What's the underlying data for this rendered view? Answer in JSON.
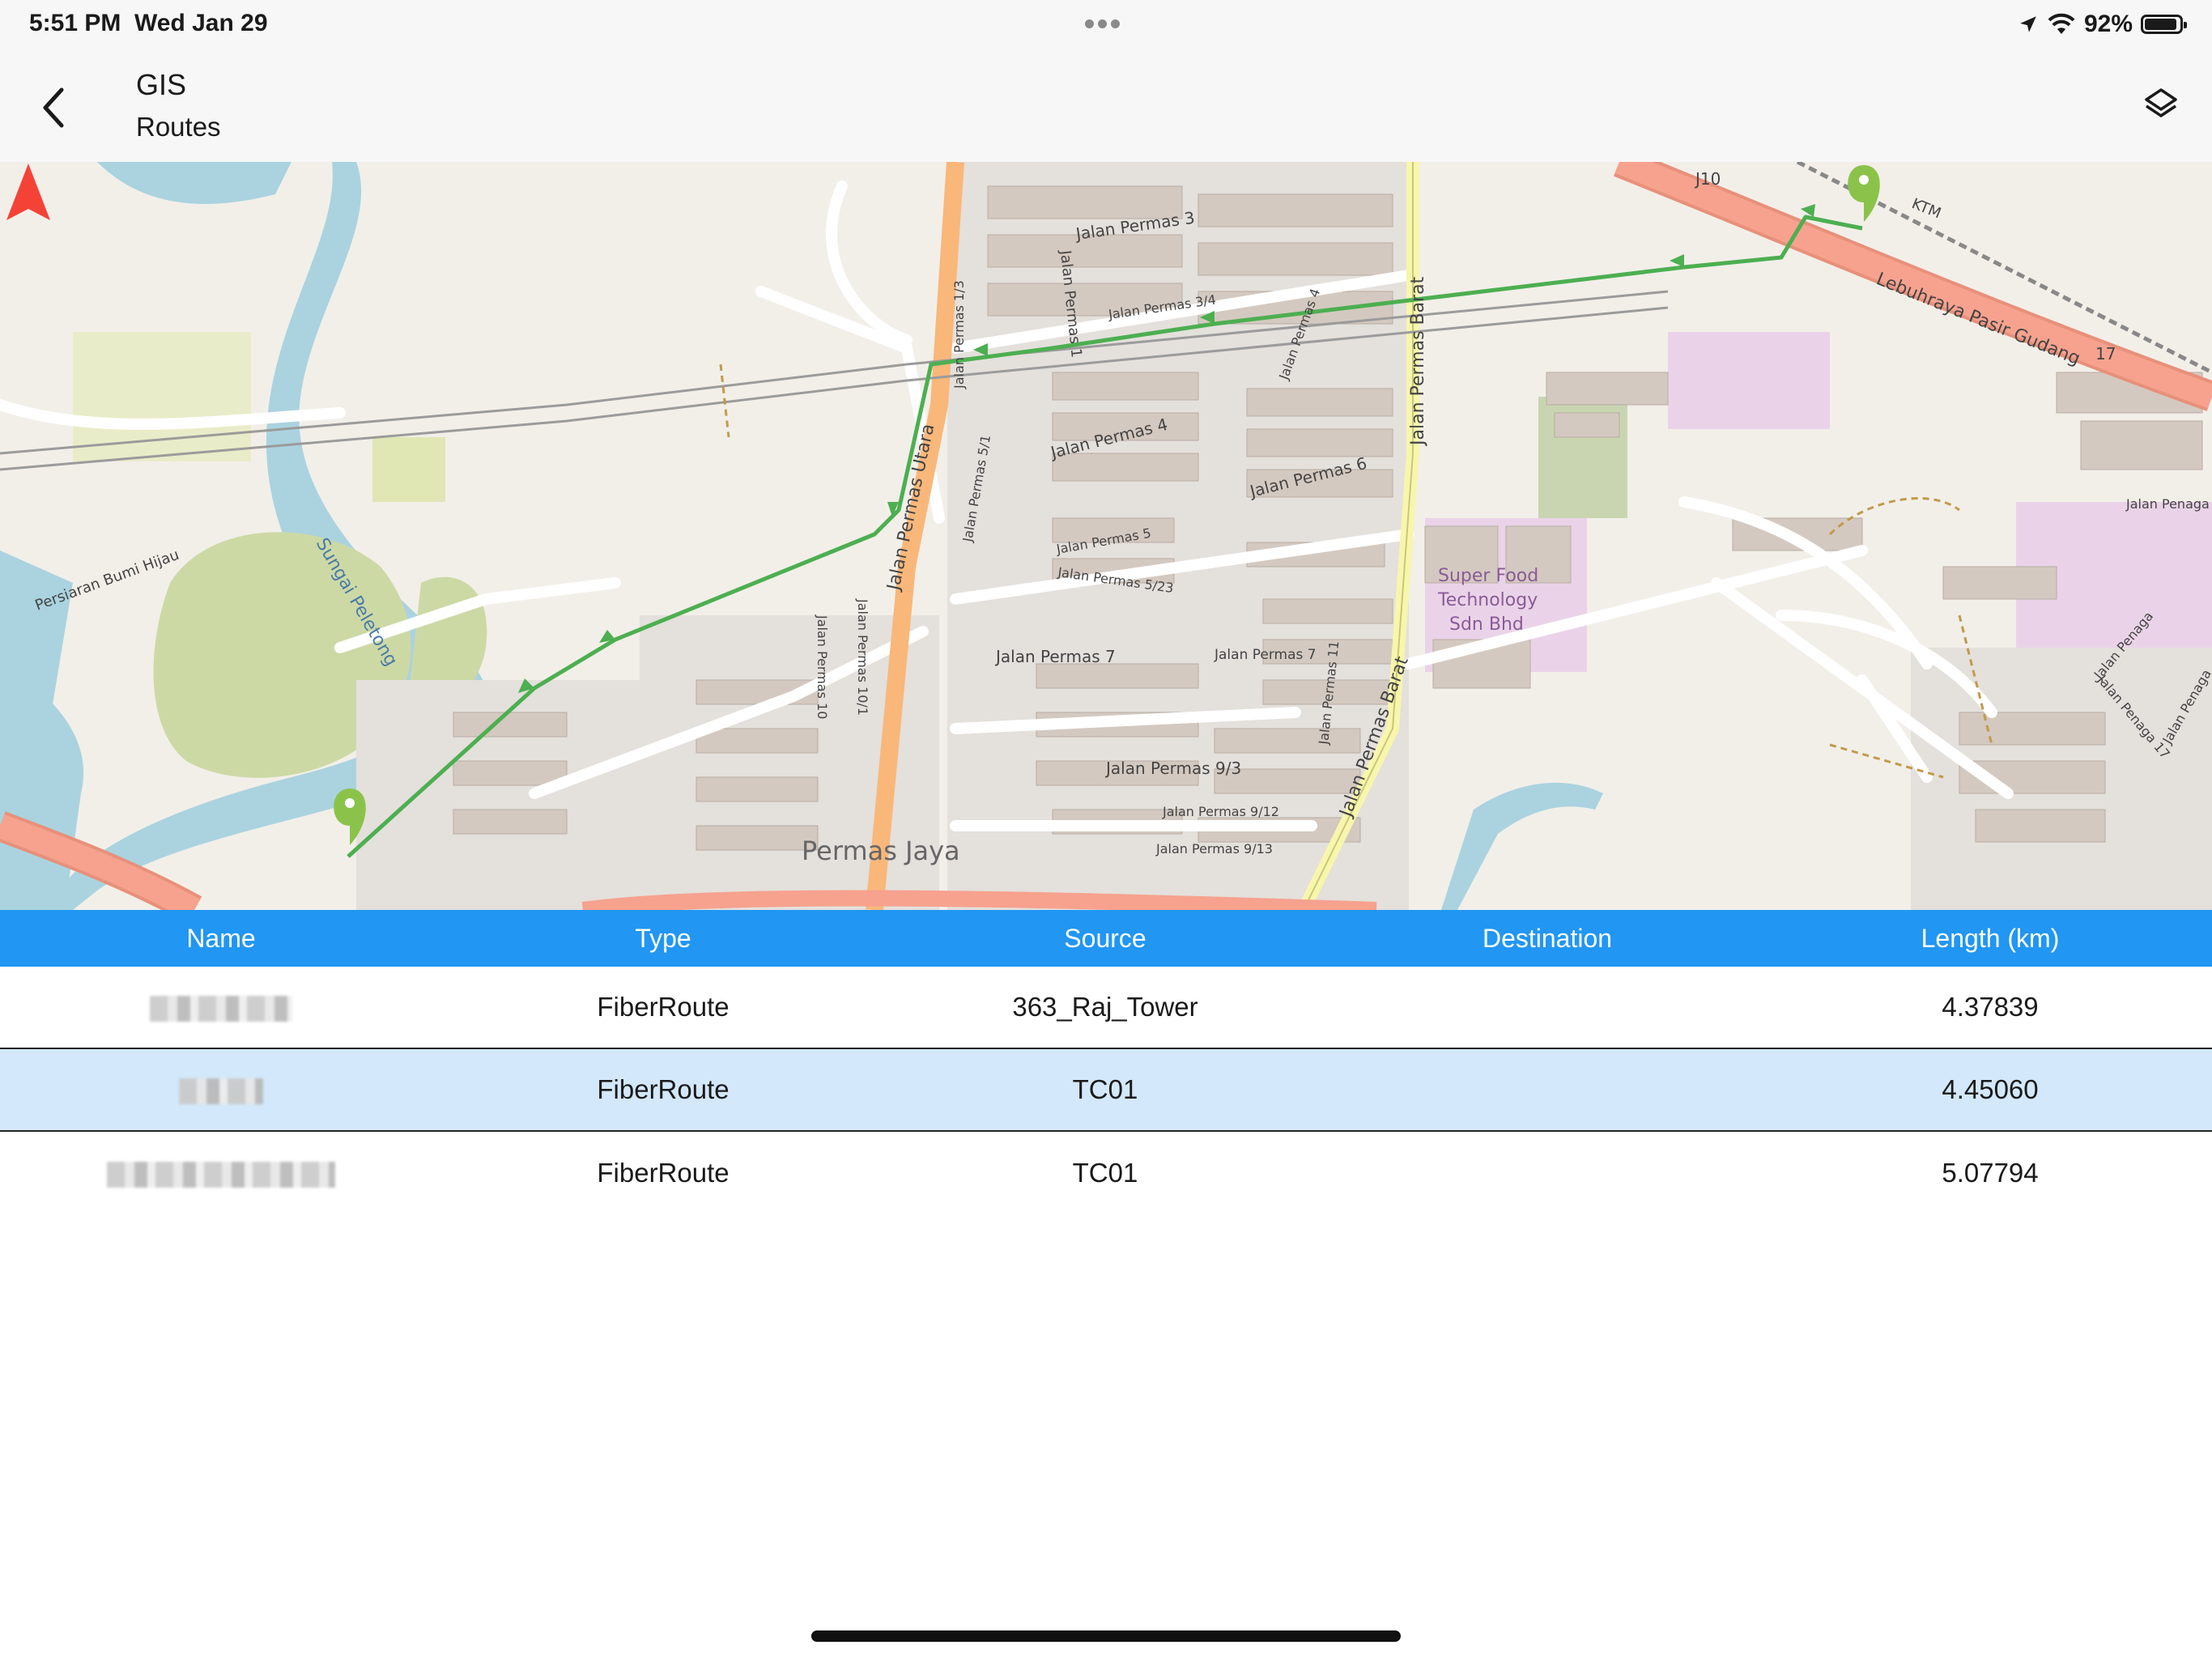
{
  "status_bar": {
    "time": "5:51 PM",
    "date": "Wed Jan 29",
    "battery": "92%",
    "battery_level": 0.92
  },
  "header": {
    "title": "GIS",
    "subtitle": "Routes"
  },
  "map": {
    "labels": {
      "permas_jaya": "Permas Jaya",
      "sungai": "Sungai Peletong",
      "persiaran": "Persiaran Bumi Hijau",
      "utara": "Jalan Permas Utara",
      "barat1": "Jalan Permas Barat",
      "barat2": "Jalan Permas Barat",
      "p3": "Jalan Permas 3",
      "p34": "Jalan Permas 3/4",
      "p4": "Jalan Permas 4",
      "p4v": "Jalan Permas 4",
      "p5": "Jalan Permas 5",
      "p523": "Jalan Permas 5/23",
      "p6": "Jalan Permas 6",
      "p7a": "Jalan Permas 7",
      "p7b": "Jalan Permas 7",
      "p93": "Jalan Permas 9/3",
      "p912": "Jalan Permas 9/12",
      "p913": "Jalan Permas 9/13",
      "p10": "Jalan Permas 10",
      "p101": "Jalan Permas 10/1",
      "p11": "Jalan Permas 11",
      "p1v": "Jalan Permas 1",
      "p51": "Jalan Permas 5/1",
      "p13": "Jalan Permas 1/3",
      "lebuhraya": "Lebuhraya Pasir Gudang",
      "j10": "J10",
      "r17": "17",
      "ktm": "KTM",
      "superfood1": "Super Food",
      "superfood2": "Technology",
      "superfood3": "Sdn Bhd",
      "penaga1": "Jalan Penaga",
      "penaga2": "Jalan Penaga",
      "penaga3": "Jalan Penaga 17",
      "penaga4": "Jalan Penaga"
    }
  },
  "table": {
    "columns": [
      "Name",
      "Type",
      "Source",
      "Destination",
      "Length (km)"
    ],
    "rows": [
      {
        "name": "",
        "type": "FiberRoute",
        "source": "363_Raj_Tower",
        "destination": "",
        "length": "4.37839",
        "selected": false
      },
      {
        "name": "",
        "type": "FiberRoute",
        "source": "TC01",
        "destination": "",
        "length": "4.45060",
        "selected": true
      },
      {
        "name": "",
        "type": "FiberRoute",
        "source": "TC01",
        "destination": "",
        "length": "5.07794",
        "selected": false
      }
    ]
  },
  "colors": {
    "accent": "#2196f3",
    "route": "#4caf50",
    "selected_row": "#d3e8fb",
    "north": "#f44336"
  },
  "icons": [
    "back-chevron-icon",
    "layers-icon",
    "location-arrow-icon",
    "wifi-icon",
    "battery-icon",
    "north-arrow-icon",
    "locate-icon",
    "map-pin-icon"
  ]
}
